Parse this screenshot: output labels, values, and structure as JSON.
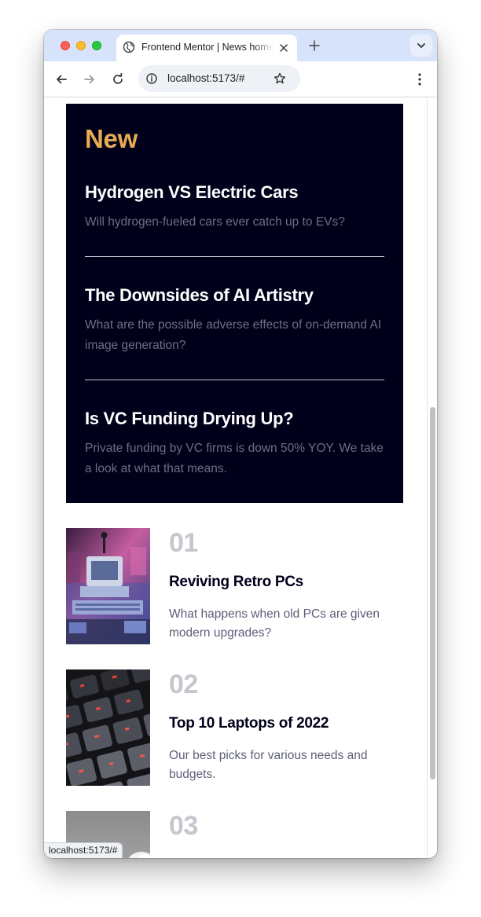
{
  "browser": {
    "tab_title": "Frontend Mentor | News homepage",
    "url": "localhost:5173/#",
    "status_url": "localhost:5173/#"
  },
  "new_section": {
    "heading": "New",
    "items": [
      {
        "title": "Hydrogen VS Electric Cars",
        "description": "Will hydrogen-fueled cars ever catch up to EVs?"
      },
      {
        "title": "The Downsides of AI Artistry",
        "description": "What are the possible adverse effects of on-demand AI image generation?"
      },
      {
        "title": "Is VC Funding Drying Up?",
        "description": "Private funding by VC firms is down 50% YOY. We take a look at what that means."
      }
    ]
  },
  "ranked": [
    {
      "number": "01",
      "title": "Reviving Retro PCs",
      "description": "What happens when old PCs are given modern upgrades?"
    },
    {
      "number": "02",
      "title": "Top 10 Laptops of 2022",
      "description": "Our best picks for various needs and budgets."
    },
    {
      "number": "03",
      "title": "",
      "description": ""
    }
  ],
  "colors": {
    "new_panel_bg": "#00001a",
    "new_heading": "#e9ab53",
    "rank_number": "#c5c6ce",
    "tab_strip": "#d7e3fb"
  }
}
